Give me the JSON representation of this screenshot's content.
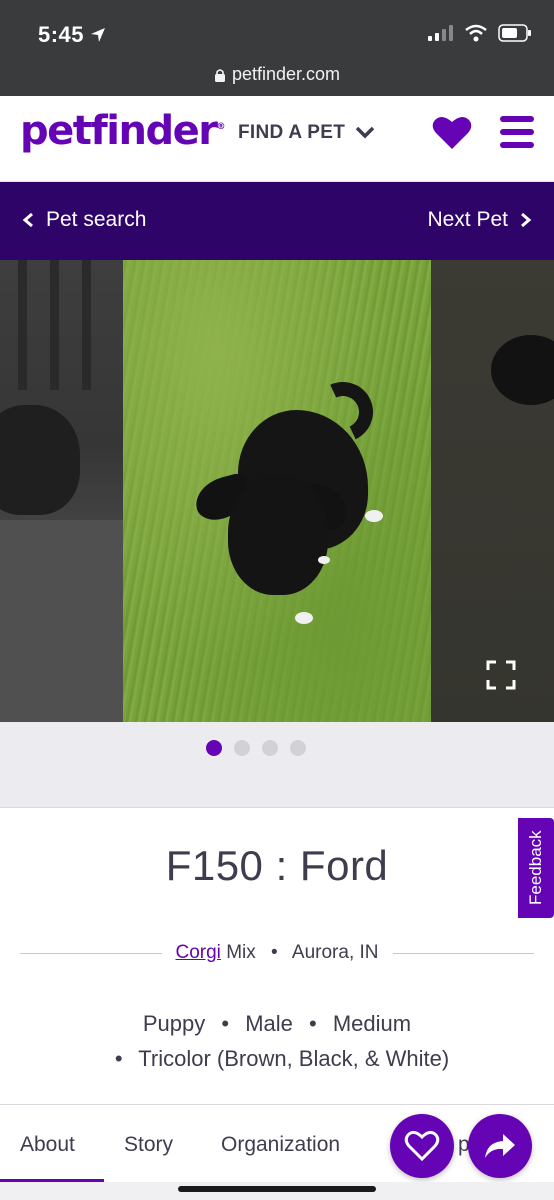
{
  "status_bar": {
    "time": "5:45",
    "url": "petfinder.com"
  },
  "header": {
    "logo": "petfinder",
    "logo_mark": "®",
    "find_a_pet": "FIND A PET"
  },
  "pet_nav": {
    "back_label": "Pet search",
    "next_label": "Next Pet"
  },
  "gallery": {
    "photo_count": 4,
    "active_index": 0
  },
  "pet": {
    "name": "F150 : Ford",
    "breed": "Corgi",
    "breed_suffix": "Mix",
    "location": "Aurora, IN",
    "age": "Puppy",
    "sex": "Male",
    "size": "Medium",
    "color": "Tricolor (Brown, Black, & White)"
  },
  "feedback": "Feedback",
  "tabs": {
    "about": "About",
    "story": "Story",
    "organization": "Organization",
    "partial": "p"
  },
  "colors": {
    "brand": "#6504b5",
    "nav": "#2e0468"
  }
}
